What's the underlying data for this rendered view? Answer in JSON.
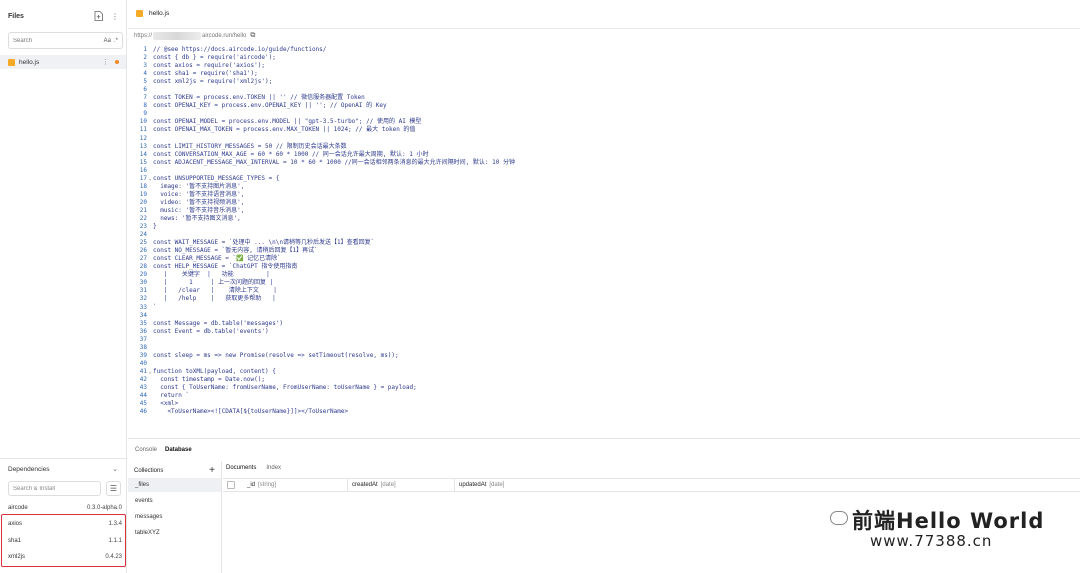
{
  "sidebar": {
    "files_title": "Files",
    "search_placeholder": "Search",
    "search_options": [
      "Aa",
      ".*"
    ],
    "files": [
      {
        "name": "hello.js"
      }
    ],
    "deps_title": "Dependencies",
    "deps_search_placeholder": "Search & Install",
    "dependencies": [
      {
        "name": "aircode",
        "version": "0.3.0-alpha.0"
      },
      {
        "name": "axios",
        "version": "1.3.4"
      },
      {
        "name": "sha1",
        "version": "1.1.1"
      },
      {
        "name": "xml2js",
        "version": "0.4.23"
      }
    ]
  },
  "editor": {
    "tab_name": "hello.js",
    "url_prefix": "https://",
    "url_suffix": "aircode.run/hello",
    "lines": [
      "// @see https://docs.aircode.io/guide/functions/",
      "const { db } = require('aircode');",
      "const axios = require('axios');",
      "const sha1 = require('sha1');",
      "const xml2js = require('xml2js');",
      "",
      "const TOKEN = process.env.TOKEN || '' // 微信服务器配置 Token",
      "const OPENAI_KEY = process.env.OPENAI_KEY || ''; // OpenAI 的 Key",
      "",
      "const OPENAI_MODEL = process.env.MODEL || \"gpt-3.5-turbo\"; // 使用的 AI 模型",
      "const OPENAI_MAX_TOKEN = process.env.MAX_TOKEN || 1024; // 最大 token 的值",
      "",
      "const LIMIT_HISTORY_MESSAGES = 50 // 限制历史会话最大条数",
      "const CONVERSATION_MAX_AGE = 60 * 60 * 1000 // 同一会话允许最大周期, 默认: 1 小时",
      "const ADJACENT_MESSAGE_MAX_INTERVAL = 10 * 60 * 1000 //同一会话相邻两条消息的最大允许间隔时间, 默认: 10 分钟",
      "",
      "const UNSUPPORTED_MESSAGE_TYPES = {",
      "  image: '暂不支持图片消息',",
      "  voice: '暂不支持语音消息',",
      "  video: '暂不支持视频消息',",
      "  music: '暂不支持音乐消息',",
      "  news: '暂不支持图文消息',",
      "}",
      "",
      "const WAIT_MESSAGE = `处理中 ... \\n\\n请稍等几秒后发送【1】查看回复`",
      "const NO_MESSAGE = `暂无内容, 请稍后回复【1】再试`",
      "const CLEAR_MESSAGE = `✅ 记忆已清除`",
      "const HELP_MESSAGE = `ChatGPT 指令使用指南",
      "   |    关键字  |   功能         |",
      "   |      1     | 上一次问题的回复 |",
      "   |   /clear   |    清除上下文    |",
      "   |   /help    |   获取更多帮助   |",
      "`",
      "",
      "const Message = db.table('messages')",
      "const Event = db.table('events')",
      "",
      "",
      "const sleep = ms => new Promise(resolve => setTimeout(resolve, ms));",
      "",
      "function toXML(payload, content) {",
      "  const timestamp = Date.now();",
      "  const { ToUserName: fromUserName, FromUserName: toUserName } = payload;",
      "  return `",
      "  <xml>",
      "    <ToUserName><![CDATA[${toUserName}]]></ToUserName>"
    ]
  },
  "panel": {
    "tabs": [
      "Console",
      "Database"
    ],
    "active_tab": "Database",
    "collections_title": "Collections",
    "collections": [
      "_files",
      "events",
      "messages",
      "tableXYZ"
    ],
    "doc_tabs": [
      "Documents",
      "Index"
    ],
    "columns": [
      {
        "name": "_id",
        "type": "[string]"
      },
      {
        "name": "createdAt",
        "type": "[date]"
      },
      {
        "name": "updatedAt",
        "type": "[date]"
      }
    ]
  },
  "watermark": {
    "line1": "前端Hello World",
    "line2": "www.77388.cn"
  }
}
